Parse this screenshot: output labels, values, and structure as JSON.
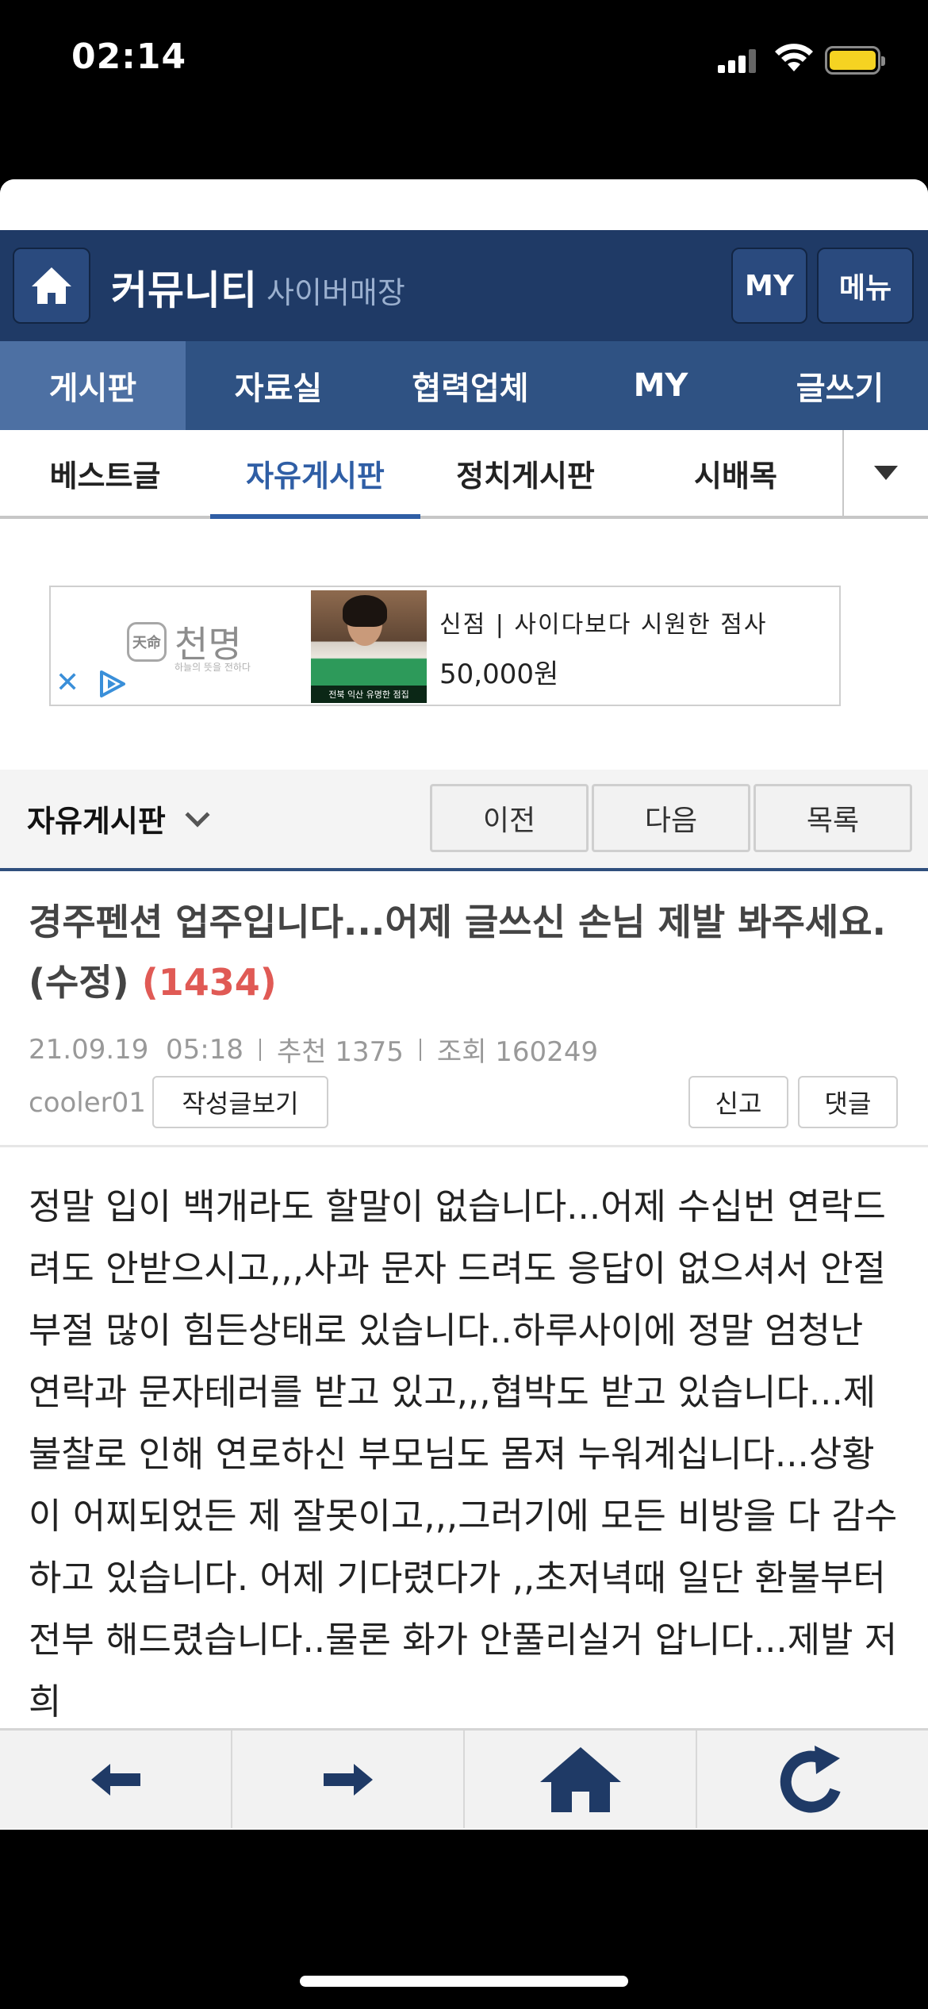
{
  "status_bar": {
    "time": "02:14"
  },
  "header": {
    "title": "커뮤니티",
    "subtitle": "사이버매장",
    "my_button": "MY",
    "menu_button": "메뉴"
  },
  "main_nav": [
    "게시판",
    "자료실",
    "협력업체",
    "MY",
    "글쓰기"
  ],
  "sub_nav": [
    "베스트글",
    "자유게시판",
    "정치게시판",
    "시배목"
  ],
  "ad": {
    "brand": "천명",
    "brand_tagline": "하늘의 뜻을 전하다",
    "seal": "天命",
    "image_caption": "전북 익산 유명한 점집",
    "title": "신점 | 사이다보다 시원한 점사",
    "price": "50,000원"
  },
  "board_bar": {
    "board_name": "자유게시판",
    "prev": "이전",
    "next": "다음",
    "list": "목록"
  },
  "post": {
    "title": "경주펜션 업주입니다...어제 글쓰신 손님 제발 봐주세요.(수정)",
    "comment_count": "(1434)",
    "date": "21.09.19  05:18",
    "recommend": "추천 1375",
    "views": "조회 160249",
    "author": "cooler01",
    "author_posts_button": "작성글보기",
    "report_button": "신고",
    "comment_button": "댓글",
    "body": "정말 입이 백개라도 할말이 없습니다...어제 수십번 연락드려도 안받으시고,,,사과 문자 드려도 응답이 없으셔서 안절부절 많이 힘든상태로 있습니다..하루사이에 정말 엄청난 연락과 문자테러를 받고 있고,,,협박도 받고 있습니다...제 불찰로 인해 연로하신 부모님도 몸져 누워계십니다...상황이 어찌되었든 제 잘못이고,,,그러기에 모든 비방을 다 감수하고 있습니다. 어제 기다렸다가 ,,초저녁때 일단 환불부터 전부 해드렸습니다..물론 화가 안풀리실거 압니다...제발 저희"
  },
  "colors": {
    "header_bg": "#1f3a66",
    "nav_bg": "#2f5283",
    "nav_active": "#4d70a3",
    "accent_blue": "#2f5ea5",
    "comment_count_red": "#e05a55"
  },
  "toolbar_icons": [
    "back-arrow-icon",
    "forward-arrow-icon",
    "home-icon",
    "refresh-icon"
  ]
}
